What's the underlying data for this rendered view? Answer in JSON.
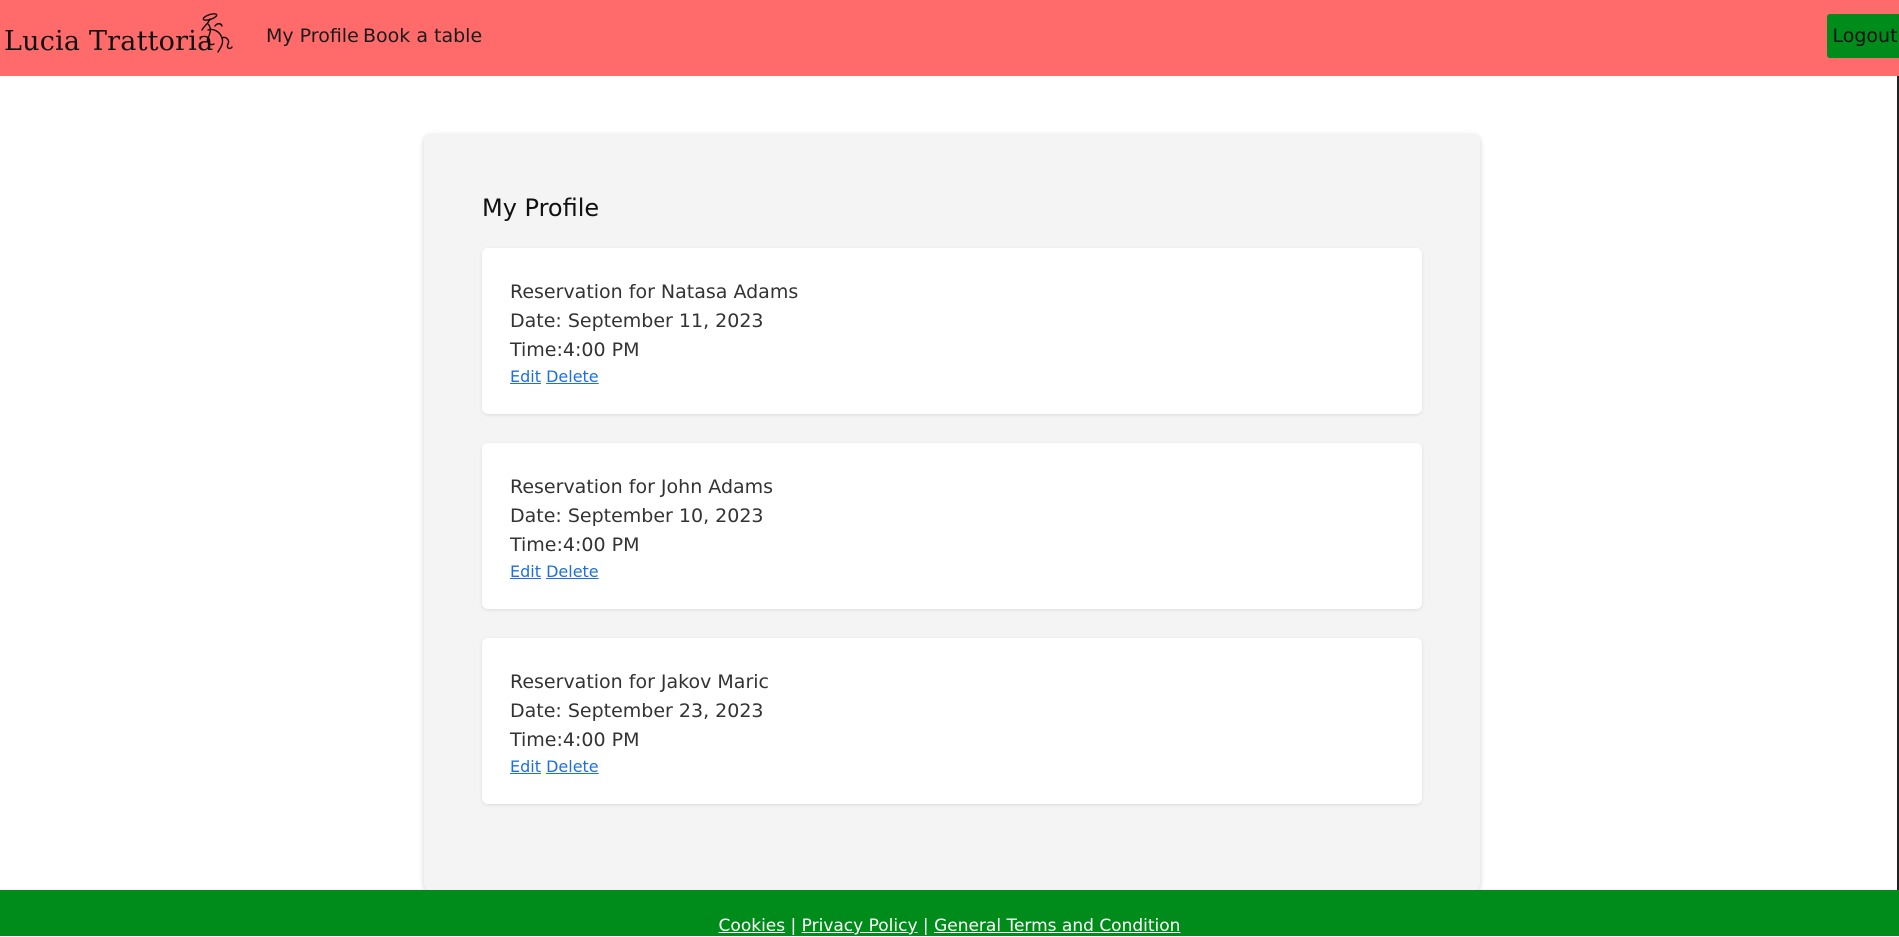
{
  "nav": {
    "brand": "Lucia Trattoria",
    "links": [
      "My Profile",
      "Book a table"
    ],
    "logout_label": "Logout"
  },
  "main": {
    "title": "My Profile",
    "reservations": [
      {
        "name_line": "Reservation for Natasa Adams",
        "date_line": "Date: September 11, 2023",
        "time_line": "Time:4:00 PM",
        "edit_label": "Edit",
        "delete_label": "Delete"
      },
      {
        "name_line": "Reservation for John Adams",
        "date_line": "Date: September 10, 2023",
        "time_line": "Time:4:00 PM",
        "edit_label": "Edit",
        "delete_label": "Delete"
      },
      {
        "name_line": "Reservation for Jakov Maric",
        "date_line": "Date: September 23, 2023",
        "time_line": "Time:4:00 PM",
        "edit_label": "Edit",
        "delete_label": "Delete"
      }
    ]
  },
  "footer": {
    "links": [
      "Cookies",
      "Privacy Policy",
      "General Terms and Condition"
    ],
    "separator": "|"
  },
  "colors": {
    "navbar": "#ff6b6b",
    "accent_green": "#008c1a",
    "panel": "#f4f4f4",
    "link": "#1e6fe0"
  },
  "icons": {
    "brand_logo": "dancing-figure-logo-icon"
  }
}
